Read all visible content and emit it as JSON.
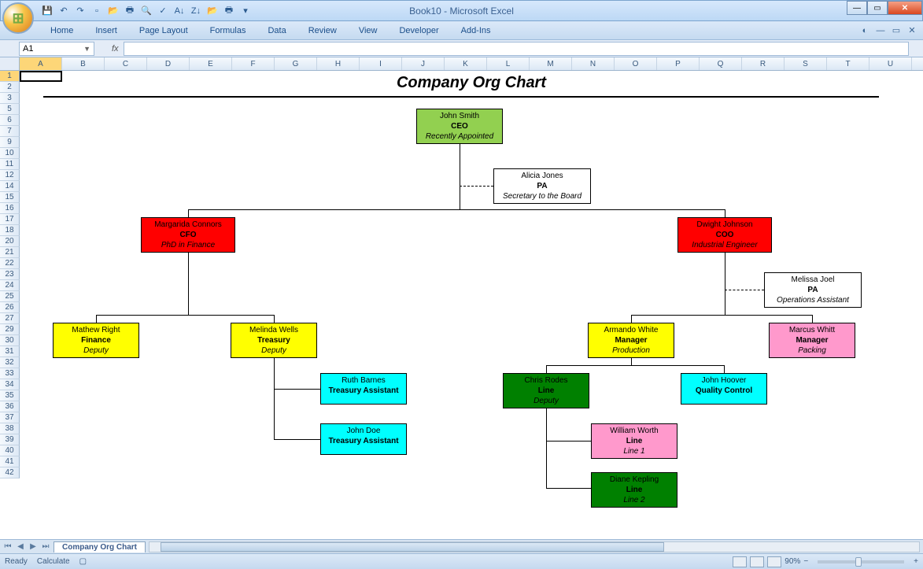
{
  "window": {
    "title": "Book10 - Microsoft Excel"
  },
  "qat": [
    "save",
    "undo",
    "redo",
    "|",
    "new",
    "open",
    "quick-print",
    "print-preview",
    "spelling",
    "sort-asc",
    "sort-desc",
    "|",
    "open2",
    "print"
  ],
  "ribbon": {
    "tabs": [
      "Home",
      "Insert",
      "Page Layout",
      "Formulas",
      "Data",
      "Review",
      "View",
      "Developer",
      "Add-Ins"
    ]
  },
  "namebox": "A1",
  "fx": "fx",
  "columns": [
    "A",
    "B",
    "C",
    "D",
    "E",
    "F",
    "G",
    "H",
    "I",
    "J",
    "K",
    "L",
    "M",
    "N",
    "O",
    "P",
    "Q",
    "R",
    "S",
    "T",
    "U"
  ],
  "rows": [
    "1",
    "2",
    "3",
    "5",
    "6",
    "7",
    "9",
    "10",
    "11",
    "12",
    "14",
    "15",
    "16",
    "17",
    "18",
    "20",
    "21",
    "22",
    "23",
    "24",
    "25",
    "26",
    "27",
    "29",
    "30",
    "31",
    "32",
    "33",
    "34",
    "35",
    "36",
    "37",
    "38",
    "39",
    "40",
    "41",
    "42"
  ],
  "chart": {
    "title": "Company Org Chart",
    "nodes": {
      "ceo": {
        "name": "John Smith",
        "role": "CEO",
        "note": "Recently Appointed"
      },
      "pa1": {
        "name": "Alicia Jones",
        "role": "PA",
        "note": "Secretary to the Board"
      },
      "cfo": {
        "name": "Margarida Connors",
        "role": "CFO",
        "note": "PhD in Finance"
      },
      "coo": {
        "name": "Dwight Johnson",
        "role": "COO",
        "note": "Industrial Engineer"
      },
      "pa2": {
        "name": "Melissa Joel",
        "role": "PA",
        "note": "Operations Assistant"
      },
      "fin": {
        "name": "Mathew Right",
        "role": "Finance",
        "note": "Deputy"
      },
      "trs": {
        "name": "Melinda Wells",
        "role": "Treasury",
        "note": "Deputy"
      },
      "mgr1": {
        "name": "Armando White",
        "role": "Manager",
        "note": "Production"
      },
      "mgr2": {
        "name": "Marcus Whitt",
        "role": "Manager",
        "note": "Packing"
      },
      "ta1": {
        "name": "Ruth Barnes",
        "role": "Treasury Assistant",
        "note": ""
      },
      "ta2": {
        "name": "John Doe",
        "role": "Treasury Assistant",
        "note": ""
      },
      "line1": {
        "name": "Chris Rodes",
        "role": "Line",
        "note": "Deputy"
      },
      "qc": {
        "name": "John Hoover",
        "role": "Quality Control",
        "note": ""
      },
      "line2": {
        "name": "William Worth",
        "role": "Line",
        "note": "Line 1"
      },
      "line3": {
        "name": "Diane Kepling",
        "role": "Line",
        "note": "Line 2"
      }
    }
  },
  "sheet_tab": "Company Org Chart",
  "status": {
    "ready": "Ready",
    "calc": "Calculate",
    "zoom": "90%"
  }
}
